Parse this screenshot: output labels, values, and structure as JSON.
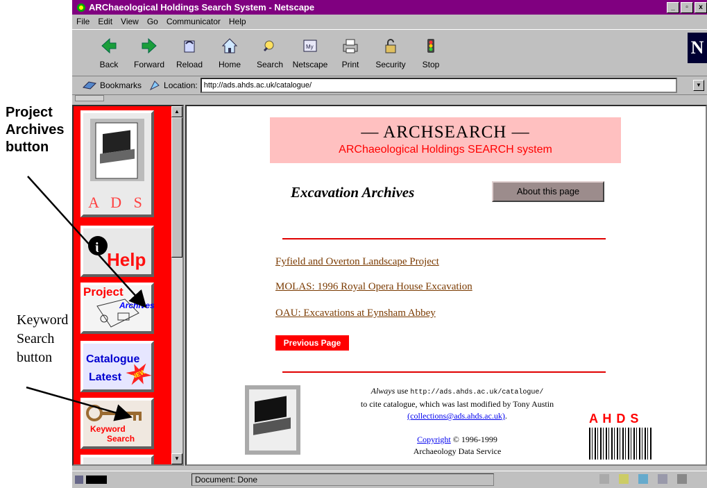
{
  "window": {
    "title": "ARChaeological Holdings Search System - Netscape",
    "controls": [
      "_",
      "▫",
      "x"
    ]
  },
  "menu": [
    "File",
    "Edit",
    "View",
    "Go",
    "Communicator",
    "Help"
  ],
  "toolbar": [
    {
      "label": "Back",
      "icon": "back-arrow-icon"
    },
    {
      "label": "Forward",
      "icon": "forward-arrow-icon"
    },
    {
      "label": "Reload",
      "icon": "reload-icon"
    },
    {
      "label": "Home",
      "icon": "home-icon"
    },
    {
      "label": "Search",
      "icon": "search-icon"
    },
    {
      "label": "Netscape",
      "icon": "netscape-icon"
    },
    {
      "label": "Print",
      "icon": "print-icon"
    },
    {
      "label": "Security",
      "icon": "lock-icon"
    },
    {
      "label": "Stop",
      "icon": "stop-icon"
    }
  ],
  "location": {
    "bookmarks": "Bookmarks",
    "label": "Location:",
    "url": "http://ads.ahds.ac.uk/catalogue/"
  },
  "sidebar": {
    "ads_letters": "A D S",
    "help": "Help",
    "project": "Project",
    "archives": "Archives",
    "catalogue": "Catalogue",
    "latest": "Latest",
    "new_badge": "NEW",
    "keyword": "Keyword",
    "search": "Search"
  },
  "main": {
    "banner_title": "— ARCHSEARCH —",
    "banner_subtitle": "ARChaeological Holdings SEARCH system",
    "page_title": "Excavation Archives",
    "about_button": "About this page",
    "links": [
      "Fyfield and Overton Landscape Project",
      "MOLAS: 1996 Royal Opera House Excavation",
      "OAU: Excavations at Eynsham Abbey"
    ],
    "prev_button": "Previous Page",
    "footer": {
      "always": "Always",
      "use": " use ",
      "cite_url": "http://ads.ahds.ac.uk/catalogue/",
      "line2": "to cite catalogue, which was last modified by Tony Austin",
      "email": "(collections@ads.ahds.ac.uk)",
      "copyright_link": "Copyright",
      "copyright_rest": " © 1996-1999",
      "org": "Archaeology Data Service"
    },
    "ahds_logo": "A H D S"
  },
  "status": {
    "text": "Document: Done"
  },
  "annotations": {
    "project_archives": [
      "Project",
      "Archives",
      "button"
    ],
    "keyword_search": [
      "Keyword",
      "Search",
      "button"
    ]
  },
  "colors": {
    "titlebar": "#800080",
    "sidebar_bg": "#ff0000",
    "banner_bg": "#ffc0c0",
    "link": "#7a3a00"
  }
}
